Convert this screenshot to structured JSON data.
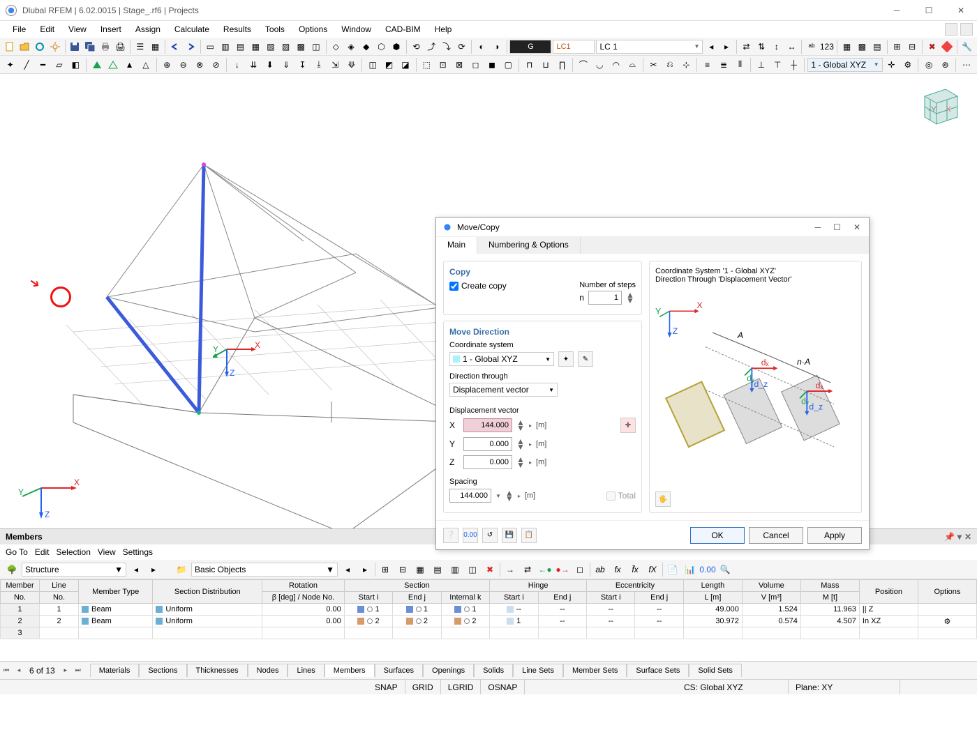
{
  "titlebar": {
    "title": "Dlubal RFEM | 6.02.0015 | Stage_.rf6 | Projects"
  },
  "menubar": [
    "File",
    "Edit",
    "View",
    "Insert",
    "Assign",
    "Calculate",
    "Results",
    "Tools",
    "Options",
    "Window",
    "CAD-BIM",
    "Help"
  ],
  "toolbar1": {
    "lc_badge": "G",
    "lc_code": "LC1",
    "lc_name": "LC 1"
  },
  "toolbar2": {
    "cs_combo": "1 - Global XYZ"
  },
  "viewport": {
    "axis_x": "X",
    "axis_y": "Y",
    "axis_z": "Z"
  },
  "dialog": {
    "title": "Move/Copy",
    "tabs": [
      "Main",
      "Numbering & Options"
    ],
    "copy": {
      "title": "Copy",
      "create_label": "Create copy",
      "create_checked": true,
      "steps_label": "Number of steps",
      "steps_prefix": "n",
      "steps_value": "1"
    },
    "move": {
      "title": "Move Direction",
      "cs_label": "Coordinate system",
      "cs_value": "1 - Global XYZ",
      "dir_label": "Direction through",
      "dir_value": "Displacement vector",
      "vec_label": "Displacement vector",
      "x_label": "X",
      "x_value": "144.000",
      "x_unit": "[m]",
      "y_label": "Y",
      "y_value": "0.000",
      "y_unit": "[m]",
      "z_label": "Z",
      "z_value": "0.000",
      "z_unit": "[m]",
      "spacing_label": "Spacing",
      "spacing_value": "144.000",
      "spacing_unit": "[m]",
      "total_label": "Total"
    },
    "right": {
      "line1": "Coordinate System '1 - Global XYZ'",
      "line2": "Direction Through 'Displacement Vector'",
      "ax_x": "X",
      "ax_y": "Y",
      "ax_z": "Z",
      "dx": "dₓ",
      "dy": "dᵧ",
      "dz": "d_z",
      "A": "A",
      "nA": "n·A"
    },
    "buttons": {
      "ok": "OK",
      "cancel": "Cancel",
      "apply": "Apply"
    }
  },
  "panel": {
    "title": "Members",
    "menu": [
      "Go To",
      "Edit",
      "Selection",
      "View",
      "Settings"
    ],
    "combo1": "Structure",
    "combo2": "Basic Objects",
    "headers_top": [
      "Member",
      "Line",
      "",
      "",
      "Rotation",
      "Section",
      "",
      "",
      "Hinge",
      "",
      "Eccentricity",
      "",
      "Length",
      "Volume",
      "Mass",
      "",
      ""
    ],
    "headers_bot": [
      "No.",
      "No.",
      "Member Type",
      "Section Distribution",
      "β [deg] / Node No.",
      "Start i",
      "End j",
      "Internal k",
      "Start i",
      "End j",
      "Start i",
      "End j",
      "L [m]",
      "V [m³]",
      "M [t]",
      "Position",
      "Options"
    ],
    "rows": [
      {
        "no": "1",
        "line": "1",
        "type": "Beam",
        "dist": "Uniform",
        "rot": "0.00",
        "si": "1",
        "ej": "1",
        "ik": "1",
        "hi": "--",
        "hj": "--",
        "ei": "--",
        "ee": "--",
        "len": "49.000",
        "vol": "1.524",
        "mass": "11.963",
        "pos": "|| Z",
        "opt": ""
      },
      {
        "no": "2",
        "line": "2",
        "type": "Beam",
        "dist": "Uniform",
        "rot": "0.00",
        "si": "2",
        "ej": "2",
        "ik": "2",
        "hi": "1",
        "hj": "--",
        "ei": "--",
        "ee": "--",
        "len": "30.972",
        "vol": "0.574",
        "mass": "4.507",
        "pos": "In XZ",
        "opt": "⚙"
      }
    ],
    "page": "6 of 13",
    "btabs": [
      "Materials",
      "Sections",
      "Thicknesses",
      "Nodes",
      "Lines",
      "Members",
      "Surfaces",
      "Openings",
      "Solids",
      "Line Sets",
      "Member Sets",
      "Surface Sets",
      "Solid Sets"
    ]
  },
  "statusbar": {
    "snap": "SNAP",
    "grid": "GRID",
    "lgrid": "LGRID",
    "osnap": "OSNAP",
    "cs": "CS: Global XYZ",
    "plane": "Plane: XY"
  }
}
